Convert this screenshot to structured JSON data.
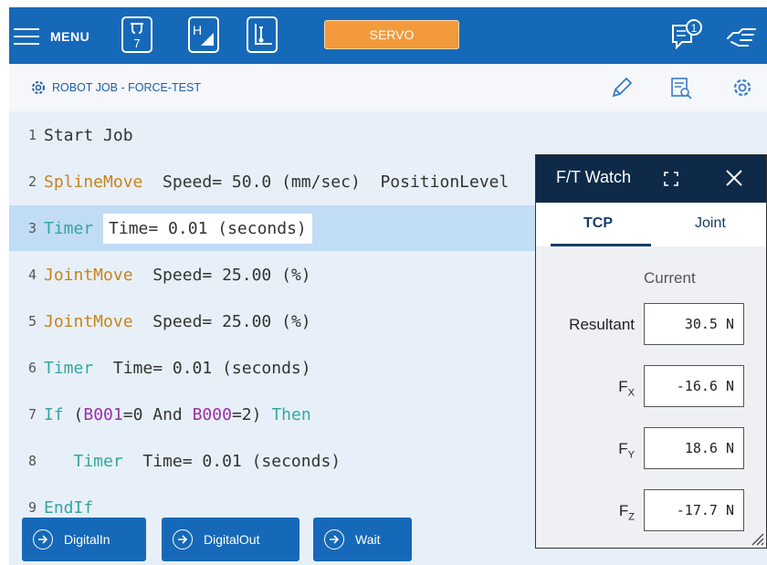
{
  "topbar": {
    "menu_label": "MENU",
    "tool_number": "7",
    "servo_label": "SERVO",
    "notification_count": "1"
  },
  "breadcrumb": {
    "label": "ROBOT JOB - FORCE-TEST"
  },
  "lines": [
    {
      "num": "1",
      "parts": [
        {
          "t": "Start Job",
          "c": "txt"
        }
      ]
    },
    {
      "num": "2",
      "parts": [
        {
          "t": "SplineMove",
          "c": "kw-orange"
        },
        {
          "t": "  Speed= 50.0 (mm/sec)  PositionLevel",
          "c": "txt"
        }
      ]
    },
    {
      "num": "3",
      "parts": [
        {
          "t": "Timer",
          "c": "kw-teal"
        },
        {
          "t": " ",
          "c": "txt"
        },
        {
          "t": "Time= 0.01 (seconds)",
          "c": "txt hl-box"
        }
      ]
    },
    {
      "num": "4",
      "parts": [
        {
          "t": "JointMove",
          "c": "kw-orange"
        },
        {
          "t": "  Speed= 25.00 (%)",
          "c": "txt"
        }
      ]
    },
    {
      "num": "5",
      "parts": [
        {
          "t": "JointMove",
          "c": "kw-orange"
        },
        {
          "t": "  Speed= 25.00 (%)",
          "c": "txt"
        }
      ]
    },
    {
      "num": "6",
      "parts": [
        {
          "t": "Timer",
          "c": "kw-teal"
        },
        {
          "t": "  Time= 0.01 (seconds)",
          "c": "txt"
        }
      ]
    },
    {
      "num": "7",
      "parts": [
        {
          "t": "If",
          "c": "kw-teal"
        },
        {
          "t": " (",
          "c": "txt"
        },
        {
          "t": "B001",
          "c": "kw-purple"
        },
        {
          "t": "=0 And ",
          "c": "txt"
        },
        {
          "t": "B000",
          "c": "kw-purple"
        },
        {
          "t": "=2) ",
          "c": "txt"
        },
        {
          "t": "Then",
          "c": "kw-teal"
        }
      ]
    },
    {
      "num": "8",
      "parts": [
        {
          "t": "   Timer",
          "c": "kw-teal"
        },
        {
          "t": "  Time= 0.01 (seconds)",
          "c": "txt"
        }
      ]
    },
    {
      "num": "9",
      "parts": [
        {
          "t": "EndIf",
          "c": "kw-teal"
        }
      ]
    }
  ],
  "selected_line": "3",
  "bottom_buttons": {
    "digital_in": "DigitalIn",
    "digital_out": "DigitalOut",
    "wait": "Wait"
  },
  "ft_watch": {
    "title": "F/T Watch",
    "tab_tcp": "TCP",
    "tab_joint": "Joint",
    "current_label": "Current",
    "resultant_label": "Resultant",
    "resultant_value": "30.5 N",
    "fx_label_main": "F",
    "fx_label_sub": "X",
    "fx_value": "-16.6 N",
    "fy_label_main": "F",
    "fy_label_sub": "Y",
    "fy_value": "18.6 N",
    "fz_label_main": "F",
    "fz_label_sub": "Z",
    "fz_value": "-17.7 N"
  },
  "colors": {
    "primary_blue": "#1669b8",
    "servo_orange": "#f39a3c",
    "panel_header": "#0e2a48",
    "selected_row": "#c1dcf5"
  }
}
